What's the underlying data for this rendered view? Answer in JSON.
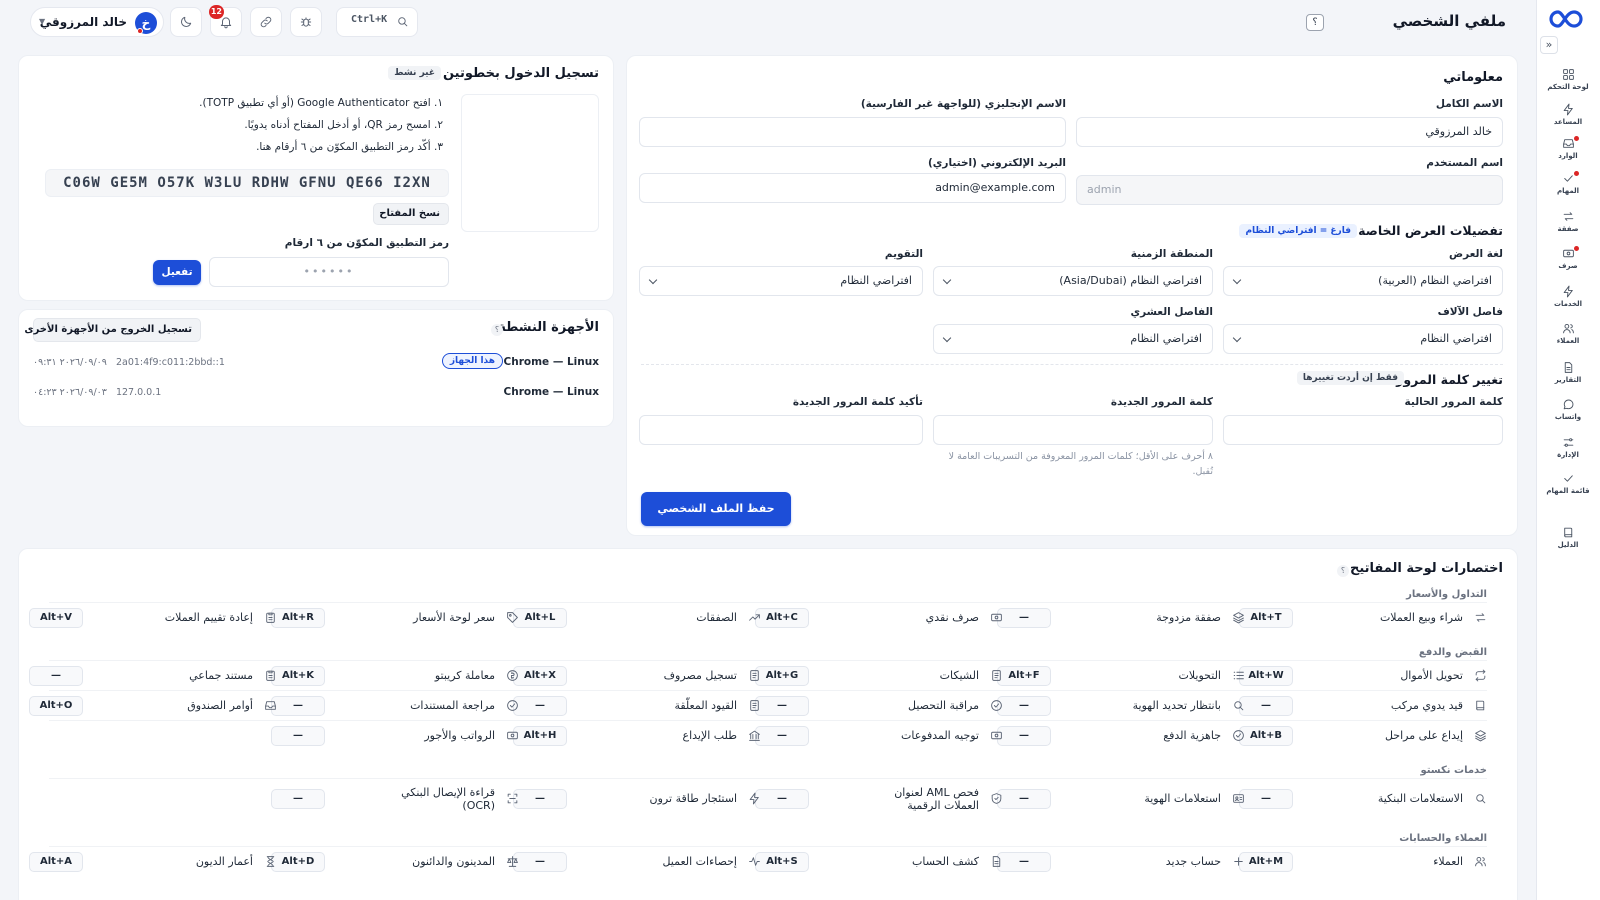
{
  "page": {
    "title": "ملفي الشخصي",
    "help_badge": "؟"
  },
  "rail": {
    "collapse_glyph": "«",
    "items": [
      {
        "label": "لوحة التحكم",
        "icon": "grid-icon"
      },
      {
        "label": "المساعد",
        "icon": "bolt-icon"
      },
      {
        "label": "الوارد",
        "icon": "inbox-icon",
        "dot": true
      },
      {
        "label": "المهام",
        "icon": "check-icon",
        "dot": true
      },
      {
        "label": "صفقة",
        "icon": "exchange-icon"
      },
      {
        "label": "صرف",
        "icon": "cash-icon",
        "dot": true
      },
      {
        "label": "الخدمات",
        "icon": "bolt-icon"
      },
      {
        "label": "العملاء",
        "icon": "users-icon"
      },
      {
        "label": "التقارير",
        "icon": "file-icon"
      },
      {
        "label": "واتساب",
        "icon": "chat-icon"
      },
      {
        "label": "الإدارة",
        "icon": "sliders-icon"
      },
      {
        "label": "قائمة المهام",
        "icon": "check-icon"
      },
      {
        "label": "الدليل",
        "icon": "book-icon"
      }
    ]
  },
  "topbar": {
    "user_name": "خالد المرزوقي",
    "user_initial": "خ",
    "notifications_count": "12",
    "search_shortcut": "Ctrl+K"
  },
  "profile": {
    "section_title": "معلوماتي",
    "full_name": {
      "label": "الاسم الكامل",
      "value": "خالد المرزوقي"
    },
    "english_name": {
      "label": "الاسم الإنجليزي (للواجهة غير الفارسية)",
      "value": ""
    },
    "username": {
      "label": "اسم المستخدم",
      "value": "admin"
    },
    "email": {
      "label": "البريد الإلكتروني (اختياري)",
      "value": "admin@example.com"
    },
    "display_prefs": {
      "title": "تفضيلات العرض الخاصة بي",
      "hint": "فارغ = افتراضي النظام",
      "display_language": {
        "label": "لغة العرض",
        "value": "افتراضي النظام (العربية)"
      },
      "timezone": {
        "label": "المنطقة الزمنية",
        "value": "افتراضي النظام (Asia/Dubai)"
      },
      "calendar": {
        "label": "التقويم",
        "value": "افتراضي النظام"
      },
      "thousands_sep": {
        "label": "فاصل الآلاف",
        "value": "افتراضي النظام"
      },
      "decimal_sep": {
        "label": "الفاصل العشري",
        "value": "افتراضي النظام"
      }
    },
    "password": {
      "title": "تغيير كلمة المرور",
      "hint": "فقط إن أردت تغييرها",
      "current_label": "كلمة المرور الحالية",
      "new_label": "كلمة المرور الجديدة",
      "confirm_label": "تأكيد كلمة المرور الجديدة",
      "help": "٨ أحرف على الأقل؛ كلمات المرور المعروفة من التسريبات العامة لا تُقبل."
    },
    "save_label": "حفظ الملف الشخصي"
  },
  "twofa": {
    "title": "تسجيل الدخول بخطوتين",
    "status": "غير نشط",
    "steps": [
      "١. افتح Google Authenticator (أو أي تطبيق TOTP).",
      "٢. امسح رمز QR، أو أدخل المفتاح أدناه يدويًا.",
      "٣. أكّد رمز التطبيق المكوّن من ٦ أرقام هنا."
    ],
    "secret": "C06W GE5M O57K W3LU RDHW GFNU QE66 I2XN",
    "copy_label": "نسخ المفتاح",
    "code_label": "رمز التطبيق المكوّن من ٦ ارقام",
    "code_placeholder": "••••••",
    "activate_label": "تفعيل"
  },
  "devices": {
    "title": "الأجهزة النشطة",
    "logout_others_label": "تسجيل الخروج من الأجهزة الأخرى",
    "this_device_label": "هذا الجهاز",
    "rows": [
      {
        "name": "Chrome — Linux",
        "ip": "2a01:4f9:c011:2bbd::1",
        "time": "٢٠٢٦/٠٩/٠٩ ٠٩:٣١",
        "current": true
      },
      {
        "name": "Chrome — Linux",
        "ip": "127.0.0.1",
        "time": "٢٠٢٦/٠٩/٠٣ ٠٤:٢٣",
        "current": false
      }
    ]
  },
  "shortcuts": {
    "title": "اختصارات لوحة المفاتيح",
    "groups": [
      {
        "name": "التداول والأسعار",
        "rows": [
          [
            {
              "label": "شراء وبيع العملات",
              "key": "Alt+T",
              "icon": "exchange-icon"
            },
            {
              "label": "صفقة مزدوجة",
              "key": "—",
              "icon": "layers-icon"
            },
            {
              "label": "صرف نقدي",
              "key": "Alt+C",
              "icon": "cash-icon"
            },
            {
              "label": "الصفقات",
              "key": "Alt+L",
              "icon": "trend-icon"
            },
            {
              "label": "سعر لوحة الأسعار",
              "key": "Alt+R",
              "icon": "tag-icon"
            },
            {
              "label": "إعادة تقييم العملات",
              "key": "Alt+V",
              "icon": "clipboard-icon"
            }
          ]
        ]
      },
      {
        "name": "القبض والدفع",
        "rows": [
          [
            {
              "label": "تحويل الأموال",
              "key": "Alt+W",
              "icon": "repeat-icon"
            },
            {
              "label": "التحويلات",
              "key": "Alt+F",
              "icon": "list-icon"
            },
            {
              "label": "الشيكات",
              "key": "Alt+G",
              "icon": "doc-icon"
            },
            {
              "label": "تسجيل مصروف",
              "key": "Alt+X",
              "icon": "doc-icon"
            },
            {
              "label": "معاملة كريبتو",
              "key": "Alt+K",
              "icon": "coin-icon"
            },
            {
              "label": "مستند جماعي",
              "key": "—",
              "icon": "clipboard-icon"
            }
          ],
          [
            {
              "label": "قيد يدوي مركب",
              "key": "—",
              "icon": "book-icon"
            },
            {
              "label": "بانتظار تحديد الهوية",
              "key": "—",
              "icon": "search-icon"
            },
            {
              "label": "مراقبة التحصيل",
              "key": "—",
              "icon": "check-circle-icon"
            },
            {
              "label": "القيود المعلّقة",
              "key": "—",
              "icon": "doc-icon"
            },
            {
              "label": "مراجعة المستندات",
              "key": "—",
              "icon": "check-circle-icon"
            },
            {
              "label": "أوامر الصندوق",
              "key": "Alt+O",
              "icon": "inbox-icon"
            }
          ],
          [
            {
              "label": "إيداع على مراحل",
              "key": "Alt+B",
              "icon": "layers-icon"
            },
            {
              "label": "جاهزية الدفع",
              "key": "—",
              "icon": "check-circle-icon"
            },
            {
              "label": "توجيه المدفوعات",
              "key": "—",
              "icon": "cash-icon"
            },
            {
              "label": "طلب الإيداع",
              "key": "Alt+H",
              "icon": "bank-icon"
            },
            {
              "label": "الرواتب والأجور",
              "key": "—",
              "icon": "cash-icon"
            }
          ]
        ]
      },
      {
        "name": "خدمات نكستو",
        "rows": [
          [
            {
              "label": "الاستعلامات البنكية",
              "key": "—",
              "icon": "search-icon"
            },
            {
              "label": "استعلامات الهوية",
              "key": "—",
              "icon": "id-icon"
            },
            {
              "label": "فحص AML لعنوان العملات الرقمية",
              "key": "—",
              "icon": "shield-icon"
            },
            {
              "label": "استئجار طاقة ترون",
              "key": "—",
              "icon": "bolt-icon"
            },
            {
              "label": "قراءة الإيصال البنكي (OCR)",
              "key": "—",
              "icon": "scan-icon"
            }
          ]
        ]
      },
      {
        "name": "العملاء والحسابات",
        "rows": [
          [
            {
              "label": "العملاء",
              "key": "Alt+M",
              "icon": "users-icon"
            },
            {
              "label": "حساب جديد",
              "key": "—",
              "icon": "plus-icon"
            },
            {
              "label": "كشف الحساب",
              "key": "Alt+S",
              "icon": "file-icon"
            },
            {
              "label": "إحصاءات العميل",
              "key": "—",
              "icon": "pulse-icon"
            },
            {
              "label": "المدينون والدائنون",
              "key": "Alt+D",
              "icon": "scale-icon"
            },
            {
              "label": "أعمار الديون",
              "key": "Alt+A",
              "icon": "hourglass-icon"
            }
          ]
        ]
      }
    ]
  },
  "colors": {
    "primary": "#1d4ed8",
    "danger": "#dc2626",
    "background": "#f3f5f9"
  }
}
